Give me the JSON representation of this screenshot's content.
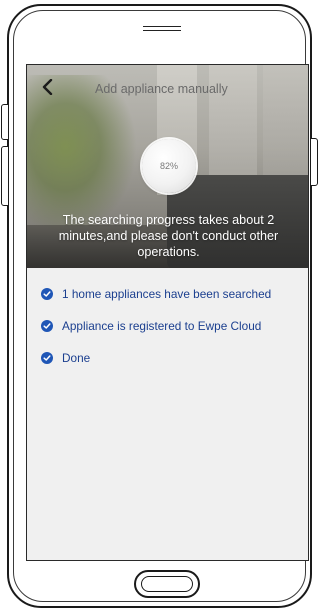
{
  "header": {
    "back_icon": "chevron-left-icon",
    "title": "Add appliance manually"
  },
  "progress": {
    "value_percent": 82,
    "label": "82%"
  },
  "message": "The searching progress takes about 2 minutes,and please don't conduct other operations.",
  "steps": [
    {
      "text": "1 home appliances have been searched",
      "icon": "check-circle-icon",
      "status": "complete"
    },
    {
      "text": "Appliance is registered to Ewpe Cloud",
      "icon": "check-circle-icon",
      "status": "complete"
    },
    {
      "text": "Done",
      "icon": "check-circle-icon",
      "status": "complete"
    }
  ],
  "colors": {
    "accent": "#1f56b6",
    "step_text": "#1b3f8f",
    "screen_bg": "#f0f0f0"
  }
}
